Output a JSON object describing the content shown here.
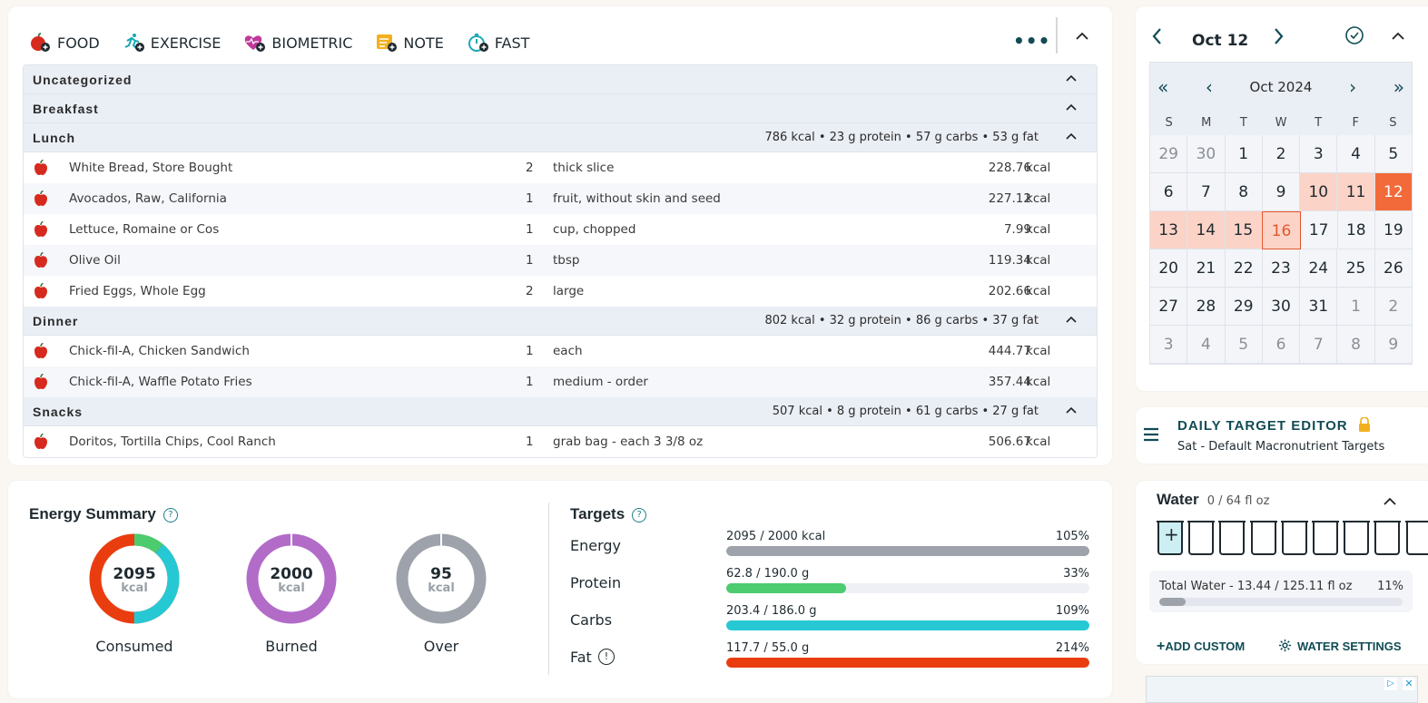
{
  "add_buttons": [
    {
      "label": "FOOD",
      "icon": "apple-plus-icon"
    },
    {
      "label": "EXERCISE",
      "icon": "runner-plus-icon"
    },
    {
      "label": "BIOMETRIC",
      "icon": "heart-plus-icon"
    },
    {
      "label": "NOTE",
      "icon": "note-plus-icon"
    },
    {
      "label": "FAST",
      "icon": "timer-plus-icon"
    }
  ],
  "more_label": "•••",
  "meals": [
    {
      "name": "Uncategorized",
      "totals": "",
      "items": []
    },
    {
      "name": "Breakfast",
      "totals": "",
      "items": []
    },
    {
      "name": "Lunch",
      "totals": "786 kcal • 23 g protein • 57 g carbs • 53 g fat",
      "items": [
        {
          "name": "White Bread, Store Bought",
          "qty": "2",
          "unit": "thick slice",
          "kcal": "228.76",
          "kcal_unit": "kcal"
        },
        {
          "name": "Avocados, Raw, California",
          "qty": "1",
          "unit": "fruit, without skin and seed",
          "kcal": "227.12",
          "kcal_unit": "kcal"
        },
        {
          "name": "Lettuce, Romaine or Cos",
          "qty": "1",
          "unit": "cup, chopped",
          "kcal": "7.99",
          "kcal_unit": "kcal"
        },
        {
          "name": "Olive Oil",
          "qty": "1",
          "unit": "tbsp",
          "kcal": "119.34",
          "kcal_unit": "kcal"
        },
        {
          "name": "Fried Eggs, Whole Egg",
          "qty": "2",
          "unit": "large",
          "kcal": "202.66",
          "kcal_unit": "kcal"
        }
      ]
    },
    {
      "name": "Dinner",
      "totals": "802 kcal • 32 g protein • 86 g carbs • 37 g fat",
      "items": [
        {
          "name": "Chick-fil-A, Chicken Sandwich",
          "qty": "1",
          "unit": "each",
          "kcal": "444.77",
          "kcal_unit": "kcal"
        },
        {
          "name": "Chick-fil-A, Waffle Potato Fries",
          "qty": "1",
          "unit": "medium - order",
          "kcal": "357.44",
          "kcal_unit": "kcal"
        }
      ]
    },
    {
      "name": "Snacks",
      "totals": "507 kcal • 8 g protein • 61 g carbs • 27 g fat",
      "items": [
        {
          "name": "Doritos, Tortilla Chips, Cool Ranch",
          "qty": "1",
          "unit": "grab bag - each 3 3/8 oz",
          "kcal": "506.67",
          "kcal_unit": "kcal"
        }
      ]
    }
  ],
  "energy_summary": {
    "title": "Energy Summary",
    "help": "?",
    "rings": [
      {
        "value": "2095",
        "unit": "kcal",
        "label": "Consumed"
      },
      {
        "value": "2000",
        "unit": "kcal",
        "label": "Burned"
      },
      {
        "value": "95",
        "unit": "kcal",
        "label": "Over"
      }
    ]
  },
  "targets": {
    "title": "Targets",
    "help": "?",
    "rows": [
      {
        "name": "Energy",
        "value": "2095 / 2000 kcal",
        "pct": "105%",
        "fill": 1.0,
        "color": "#9ea2ab",
        "warn": false
      },
      {
        "name": "Protein",
        "value": "62.8 / 190.0 g",
        "pct": "33%",
        "fill": 0.33,
        "color": "#4ccb6f",
        "warn": false
      },
      {
        "name": "Carbs",
        "value": "203.4 / 186.0 g",
        "pct": "109%",
        "fill": 1.0,
        "color": "#26c9d3",
        "warn": false
      },
      {
        "name": "Fat",
        "value": "117.7 / 55.0 g",
        "pct": "214%",
        "fill": 1.0,
        "color": "#ea3d0f",
        "warn": true
      }
    ],
    "warn_glyph": "!"
  },
  "calendar": {
    "date_label": "Oct 12",
    "month_label": "Oct 2024",
    "dow": [
      "S",
      "M",
      "T",
      "W",
      "T",
      "F",
      "S"
    ],
    "weeks": [
      [
        "29",
        "30",
        "1",
        "2",
        "3",
        "4",
        "5"
      ],
      [
        "6",
        "7",
        "8",
        "9",
        "10",
        "11",
        "12"
      ],
      [
        "13",
        "14",
        "15",
        "16",
        "17",
        "18",
        "19"
      ],
      [
        "20",
        "21",
        "22",
        "23",
        "24",
        "25",
        "26"
      ],
      [
        "27",
        "28",
        "29",
        "30",
        "31",
        "1",
        "2"
      ],
      [
        "3",
        "4",
        "5",
        "6",
        "7",
        "8",
        "9"
      ]
    ],
    "selected": "12",
    "today": "16",
    "highlighted": [
      "10",
      "11",
      "13",
      "14",
      "15"
    ]
  },
  "daily_target": {
    "title": "DAILY TARGET EDITOR",
    "subtitle": "Sat - Default Macronutrient Targets"
  },
  "water": {
    "title": "Water",
    "amount": "0 / 64 fl oz",
    "plus": "+",
    "glass_count": 8,
    "total_label": "Total Water - 13.44 / 125.11 fl oz",
    "total_pct": "11%",
    "total_fill": 0.11,
    "add_custom": "ADD CUSTOM",
    "settings": "WATER SETTINGS"
  },
  "colors": {
    "consumed_orange": "#ea3d0f",
    "consumed_green": "#4ccb6f",
    "consumed_teal": "#26c9d3",
    "burned_purple": "#b26cc8",
    "over_gray": "#9ea2ab",
    "accent_teal": "#114c55",
    "selected_day": "#f26a3a"
  }
}
